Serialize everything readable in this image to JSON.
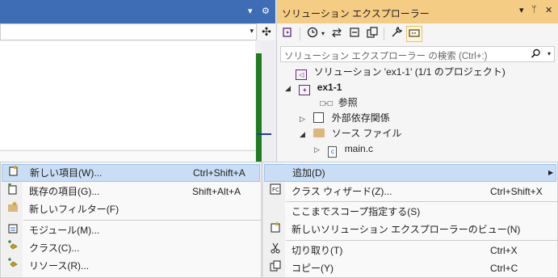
{
  "left_tab": {
    "dropdown_glyph": "▾",
    "settings_glyph": "⚙"
  },
  "nav_bar": {
    "arrow": "▾"
  },
  "split_glyph": "✣",
  "solution_explorer": {
    "title": "ソリューション エクスプローラー",
    "title_icons": {
      "dropdown": "▾",
      "pin": "ᛘ",
      "close": "✕"
    },
    "search": {
      "placeholder": "ソリューション エクスプローラー の検索 (Ctrl+:)"
    },
    "tree": [
      {
        "label": "ソリューション 'ex1-1' (1/1 のプロジェクト)",
        "expander": "",
        "icon": "solution"
      },
      {
        "label": "ex1-1",
        "expander": "◢",
        "icon": "project",
        "bold": true
      },
      {
        "label": "参照",
        "expander": "",
        "icon": "references"
      },
      {
        "label": "外部依存関係",
        "expander": "▷",
        "icon": "dependencies"
      },
      {
        "label": "ソース ファイル",
        "expander": "◢",
        "icon": "folder"
      },
      {
        "label": "main.c",
        "expander": "▷",
        "icon": "c-file"
      }
    ]
  },
  "context_menu": {
    "items": [
      {
        "label": "追加(D)",
        "shortcut": "",
        "has_submenu": true,
        "selected": true,
        "icon": ""
      },
      {
        "label": "クラス ウィザード(Z)...",
        "shortcut": "Ctrl+Shift+X",
        "icon": "class-wizard"
      },
      {
        "label": "ここまでスコープ指定する(S)",
        "shortcut": "",
        "icon": ""
      },
      {
        "label": "新しいソリューション エクスプローラーのビュー(N)",
        "shortcut": "",
        "icon": "new-view"
      },
      {
        "label": "切り取り(T)",
        "shortcut": "Ctrl+X",
        "icon": "cut"
      },
      {
        "label": "コピー(Y)",
        "shortcut": "Ctrl+C",
        "icon": "copy"
      }
    ]
  },
  "add_submenu": {
    "items": [
      {
        "label": "新しい項目(W)...",
        "shortcut": "Ctrl+Shift+A",
        "selected": true,
        "icon": "new-item"
      },
      {
        "label": "既存の項目(G)...",
        "shortcut": "Shift+Alt+A",
        "icon": "existing-item"
      },
      {
        "label": "新しいフィルター(F)",
        "shortcut": "",
        "icon": "new-filter"
      },
      {
        "label": "モジュール(M)...",
        "shortcut": "",
        "icon": "module"
      },
      {
        "label": "クラス(C)...",
        "shortcut": "",
        "icon": "class"
      },
      {
        "label": "リソース(R)...",
        "shortcut": "",
        "icon": "resource"
      }
    ]
  },
  "colors": {
    "accent_blue": "#3e6db5",
    "se_title": "#f5cc84",
    "selection": "#c9def5",
    "green_bar": "#1e7d1e"
  }
}
